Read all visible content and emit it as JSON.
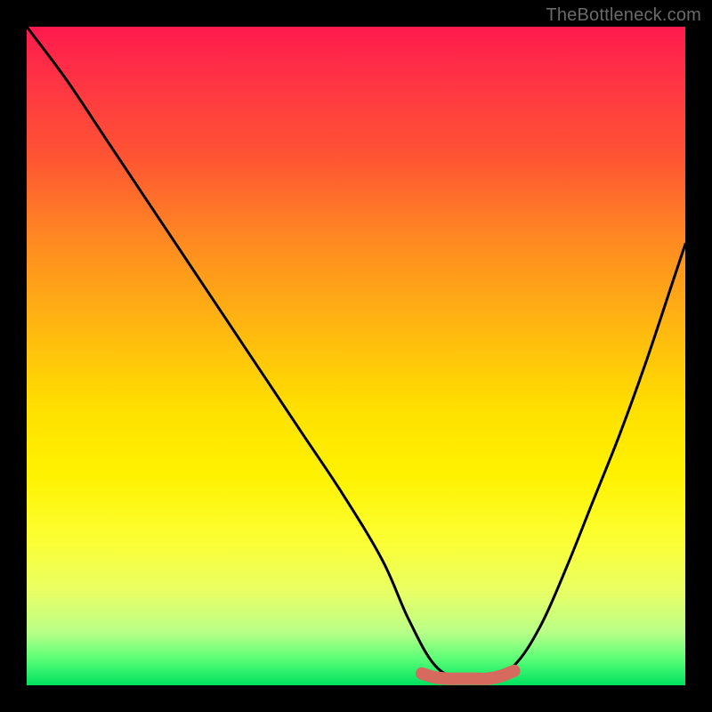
{
  "watermark": "TheBottleneck.com",
  "chart_data": {
    "type": "line",
    "title": "",
    "xlabel": "",
    "ylabel": "",
    "xlim": [
      0,
      100
    ],
    "ylim": [
      0,
      100
    ],
    "grid": false,
    "series": [
      {
        "name": "bottleneck-curve",
        "x": [
          0,
          6,
          12,
          18,
          24,
          30,
          36,
          42,
          48,
          54,
          58,
          62,
          66,
          70,
          74,
          78,
          82,
          86,
          90,
          94,
          98,
          100
        ],
        "values": [
          100,
          92,
          83,
          74,
          65,
          56,
          47,
          38,
          29,
          19,
          10,
          3,
          1,
          1,
          3,
          9,
          18,
          28,
          38,
          49,
          61,
          67
        ]
      },
      {
        "name": "optimal-band",
        "x": [
          60,
          62,
          64,
          66,
          68,
          70,
          72,
          74
        ],
        "values": [
          1.8,
          1.2,
          1.0,
          1.0,
          1.0,
          1.0,
          1.4,
          2.2
        ]
      }
    ],
    "colors": {
      "curve": "#000000",
      "band": "#d66a5f",
      "gradient_top": "#ff1a4d",
      "gradient_bottom": "#00e060"
    }
  }
}
